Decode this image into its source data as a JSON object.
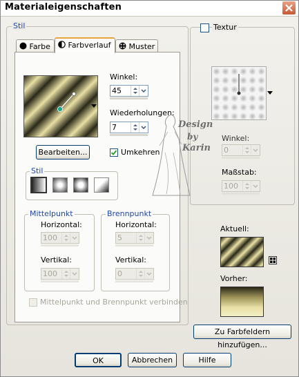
{
  "window": {
    "title": "Materialeigenschaften"
  },
  "stil_group": {
    "label": "Stil"
  },
  "tabs": [
    {
      "label": "Farbe",
      "icon": "solid-dot-icon"
    },
    {
      "label": "Farbverlauf",
      "icon": "gradient-half-icon"
    },
    {
      "label": "Muster",
      "icon": "pattern-icon"
    }
  ],
  "gradient": {
    "winkel_label": "Winkel:",
    "winkel_value": "45",
    "wiederholungen_label": "Wiederholungen:",
    "wiederholungen_value": "7",
    "bearbeiten_label": "Bearbeiten...",
    "umkehren_label": "Umkehren",
    "umkehren_checked": true,
    "stil_label": "Stil",
    "mittelpunkt": {
      "label": "Mittelpunkt",
      "horizontal_label": "Horizontal:",
      "horizontal_value": "100",
      "vertikal_label": "Vertikal:",
      "vertikal_value": "100"
    },
    "brennpunkt": {
      "label": "Brennpunkt",
      "horizontal_label": "Horizontal:",
      "horizontal_value": "5",
      "vertikal_label": "Vertikal:",
      "vertikal_value": "0"
    },
    "link_label": "Mittelpunkt und Brennpunkt verbinden"
  },
  "texture": {
    "label": "Textur",
    "winkel_label": "Winkel:",
    "winkel_value": "0",
    "massstab_label": "Maßstab:",
    "massstab_value": "100"
  },
  "watermark": {
    "line1": "Design",
    "line2": "by",
    "line3": "Karin"
  },
  "preview": {
    "aktuell_label": "Aktuell:",
    "vorher_label": "Vorher:"
  },
  "buttons": {
    "add_to_swatches": "Zu Farbfeldern hinzufügen...",
    "ok": "OK",
    "cancel": "Abbrechen",
    "help": "Hilfe"
  },
  "colors": {
    "gradient_light": "#e8e0a4",
    "gradient_mid": "#b9ab5d",
    "gradient_dark": "#2a2818",
    "accent": "#1f47ab"
  }
}
